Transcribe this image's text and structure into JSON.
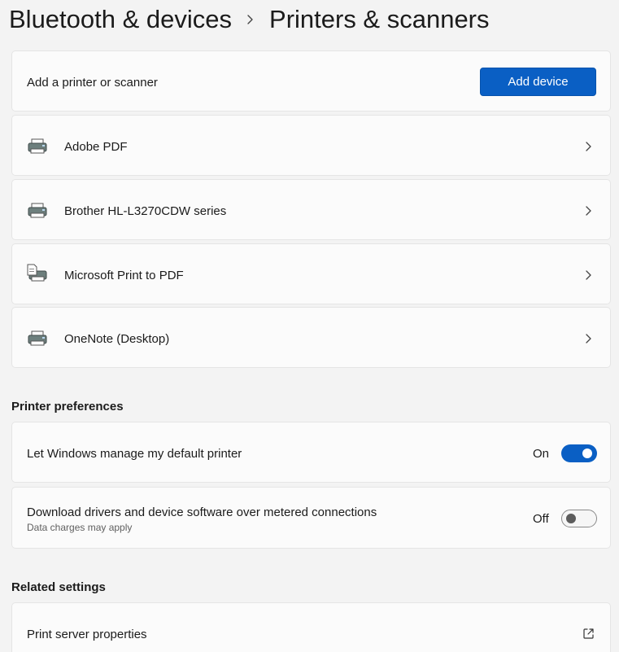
{
  "breadcrumb": {
    "parent": "Bluetooth & devices",
    "current": "Printers & scanners"
  },
  "add_printer": {
    "label": "Add a printer or scanner",
    "button_label": "Add device"
  },
  "printers": [
    {
      "name": "Adobe PDF",
      "icon": "printer-icon"
    },
    {
      "name": "Brother HL-L3270CDW series",
      "icon": "printer-icon"
    },
    {
      "name": "Microsoft Print to PDF",
      "icon": "printer-document-icon"
    },
    {
      "name": "OneNote (Desktop)",
      "icon": "printer-icon"
    }
  ],
  "printer_preferences": {
    "title": "Printer preferences",
    "manage_default": {
      "label": "Let Windows manage my default printer",
      "state_text": "On",
      "enabled": true
    },
    "metered_download": {
      "label": "Download drivers and device software over metered connections",
      "description": "Data charges may apply",
      "state_text": "Off",
      "enabled": false
    }
  },
  "related_settings": {
    "title": "Related settings",
    "items": [
      {
        "label": "Print server properties",
        "icon": "open-external-icon"
      }
    ]
  },
  "colors": {
    "accent": "#0a5fc4",
    "background": "#f3f3f3",
    "card": "#fbfbfb"
  }
}
